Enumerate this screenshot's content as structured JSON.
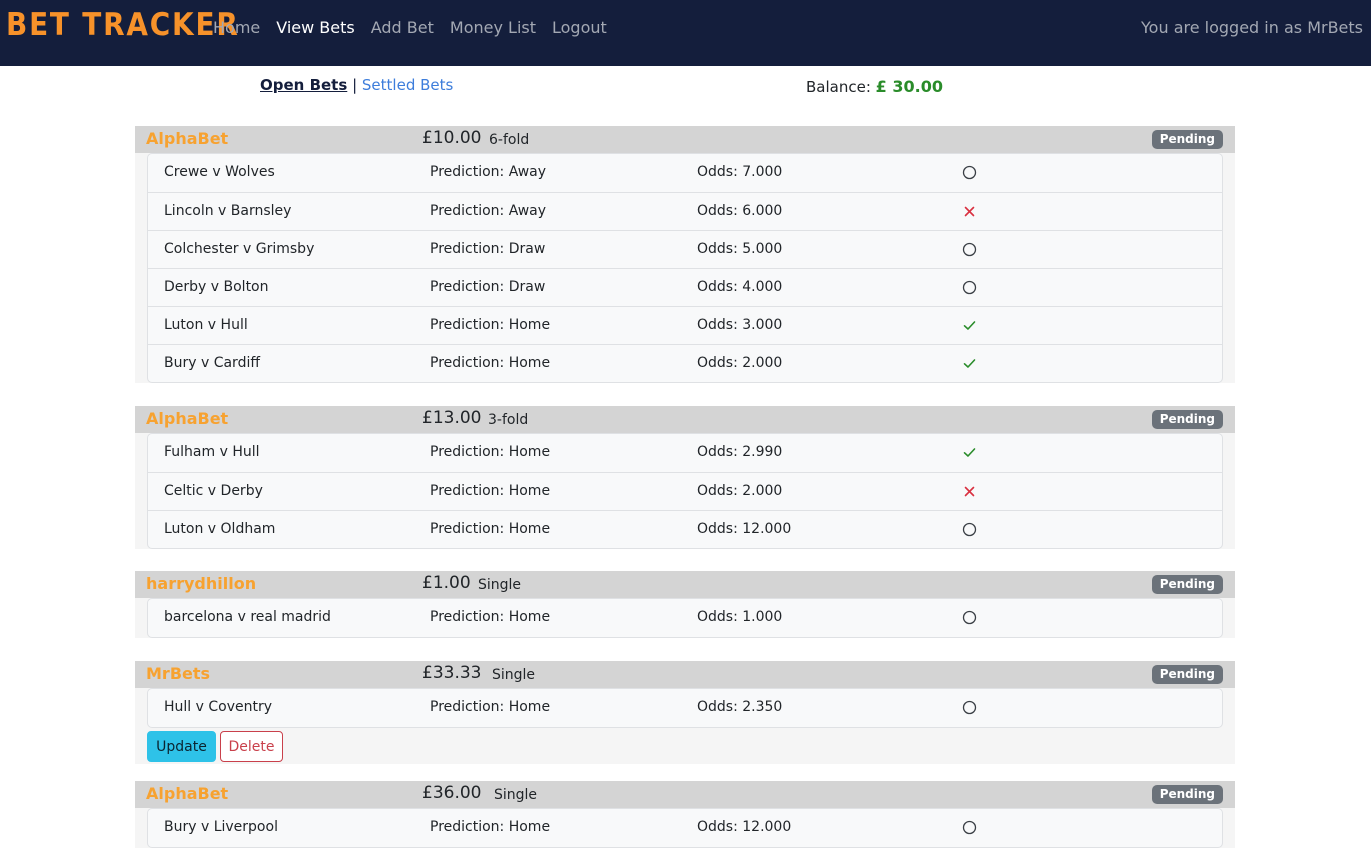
{
  "brand": "BET TRACKER",
  "nav": {
    "links": [
      {
        "label": "Home"
      },
      {
        "label": "View Bets"
      },
      {
        "label": "Add Bet"
      },
      {
        "label": "Money List"
      },
      {
        "label": "Logout"
      }
    ],
    "active": "View Bets",
    "login_status": "You are logged in as MrBets"
  },
  "tabs": {
    "open_label": "Open Bets",
    "separator": "|",
    "settled_label": "Settled Bets"
  },
  "balance": {
    "label": "Balance:",
    "value": "£ 30.00"
  },
  "colors": {
    "navbar": "#141e3c",
    "brand": "#f7922a",
    "bookie": "#f7a230",
    "balance": "#2a8c2a",
    "won": "#2a8c2a",
    "lost": "#d93040",
    "badge": "#6b727a"
  },
  "bets": [
    {
      "bookie": "AlphaBet",
      "stake": "£10.00",
      "type": "6-fold",
      "status": "Pending",
      "legs": [
        {
          "match": "Crewe v Wolves",
          "prediction": "Prediction: Away",
          "odds": "Odds: 7.000",
          "result": "pending-circle-icon"
        },
        {
          "match": "Lincoln v Barnsley",
          "prediction": "Prediction: Away",
          "odds": "Odds: 6.000",
          "result": "lost-cross-icon"
        },
        {
          "match": "Colchester v Grimsby",
          "prediction": "Prediction: Draw",
          "odds": "Odds: 5.000",
          "result": "pending-circle-icon"
        },
        {
          "match": "Derby v Bolton",
          "prediction": "Prediction: Draw",
          "odds": "Odds: 4.000",
          "result": "pending-circle-icon"
        },
        {
          "match": "Luton v Hull",
          "prediction": "Prediction: Home",
          "odds": "Odds: 3.000",
          "result": "won-check-icon"
        },
        {
          "match": "Bury v Cardiff",
          "prediction": "Prediction: Home",
          "odds": "Odds: 2.000",
          "result": "won-check-icon"
        }
      ]
    },
    {
      "bookie": "AlphaBet",
      "stake": "£13.00",
      "type": "3-fold",
      "status": "Pending",
      "legs": [
        {
          "match": "Fulham v Hull",
          "prediction": "Prediction: Home",
          "odds": "Odds: 2.990",
          "result": "won-check-icon"
        },
        {
          "match": "Celtic v Derby",
          "prediction": "Prediction: Home",
          "odds": "Odds: 2.000",
          "result": "lost-cross-icon"
        },
        {
          "match": "Luton v Oldham",
          "prediction": "Prediction: Home",
          "odds": "Odds: 12.000",
          "result": "pending-circle-icon"
        }
      ]
    },
    {
      "bookie": "harrydhillon",
      "stake": "£1.00",
      "type": "Single",
      "status": "Pending",
      "legs": [
        {
          "match": "barcelona v real madrid",
          "prediction": "Prediction: Home",
          "odds": "Odds: 1.000",
          "result": "pending-circle-icon"
        }
      ]
    },
    {
      "bookie": "MrBets",
      "stake": "£33.33",
      "type": "Single",
      "status": "Pending",
      "legs": [
        {
          "match": "Hull v Coventry",
          "prediction": "Prediction: Home",
          "odds": "Odds: 2.350",
          "result": "pending-circle-icon"
        }
      ],
      "actions": {
        "update_label": "Update",
        "delete_label": "Delete"
      }
    },
    {
      "bookie": "AlphaBet",
      "stake": "£36.00",
      "type": "Single",
      "status": "Pending",
      "legs": [
        {
          "match": "Bury v Liverpool",
          "prediction": "Prediction: Home",
          "odds": "Odds: 12.000",
          "result": "pending-circle-icon"
        }
      ]
    }
  ]
}
